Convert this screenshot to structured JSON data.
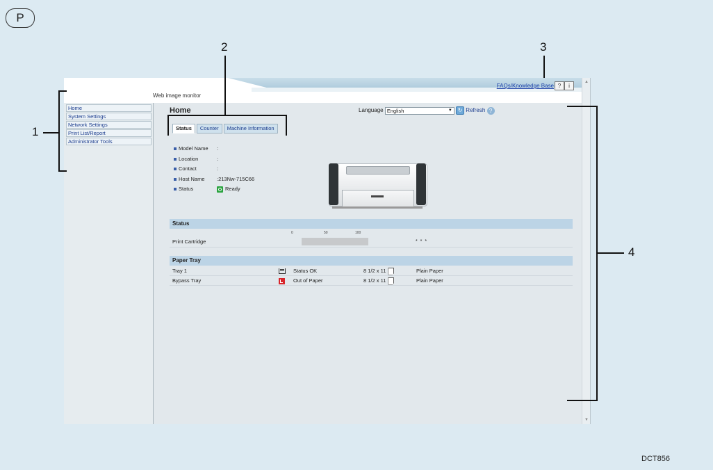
{
  "badge": "P",
  "callouts": {
    "c1": "1",
    "c2": "2",
    "c3": "3",
    "c4": "4"
  },
  "figure_id": "DCT856",
  "header": {
    "brand": "Web image monitor",
    "faq_link": "FAQs/Knowledge Base",
    "help_btn": "?",
    "info_btn": "i"
  },
  "sidebar": {
    "items": [
      {
        "label": "Home"
      },
      {
        "label": "System Settings"
      },
      {
        "label": "Network Settings"
      },
      {
        "label": "Print List/Report"
      },
      {
        "label": "Administrator Tools"
      }
    ]
  },
  "main": {
    "title": "Home",
    "language_label": "Language",
    "language_value": "English",
    "refresh_label": "Refresh",
    "tabs": [
      {
        "label": "Status",
        "active": true
      },
      {
        "label": "Counter"
      },
      {
        "label": "Machine Information"
      }
    ],
    "info": {
      "model_name": {
        "label": "Model Name",
        "value": ":"
      },
      "location": {
        "label": "Location",
        "value": ":"
      },
      "contact": {
        "label": "Contact",
        "value": ":"
      },
      "host_name": {
        "label": "Host Name",
        "value": ":213Nw-715C66"
      },
      "status": {
        "label": "Status",
        "value": "Ready"
      }
    },
    "status_section": {
      "title": "Status",
      "scale": [
        "0",
        "50",
        "100"
      ],
      "cartridge_label": "Print Cartridge",
      "cartridge_level_percent": 100,
      "cartridge_dots": "* * *"
    },
    "paper_section": {
      "title": "Paper Tray",
      "rows": [
        {
          "tray": "Tray 1",
          "status": "Status OK",
          "size": "8 1/2 x 11",
          "type": "Plain Paper"
        },
        {
          "tray": "Bypass Tray",
          "status": "Out of Paper",
          "size": "8 1/2 x 11",
          "type": "Plain Paper"
        }
      ]
    }
  }
}
